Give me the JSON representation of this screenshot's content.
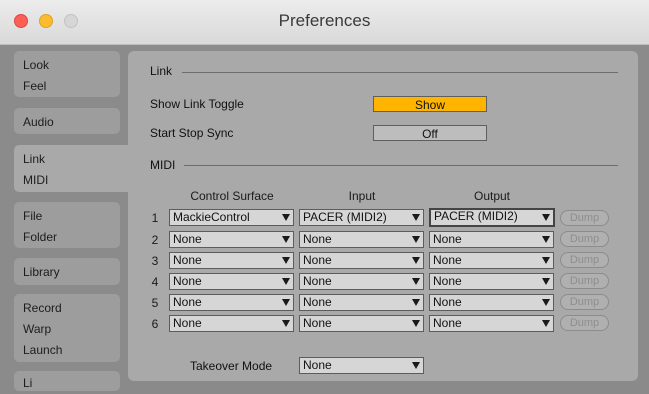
{
  "window": {
    "title": "Preferences"
  },
  "tabs": [
    {
      "lines": [
        "Look",
        "Feel"
      ]
    },
    {
      "lines": [
        "Audio"
      ]
    },
    {
      "lines": [
        "Link",
        "MIDI"
      ],
      "active": true
    },
    {
      "lines": [
        "File",
        "Folder"
      ]
    },
    {
      "lines": [
        "Library"
      ]
    },
    {
      "lines": [
        "Record",
        "Warp",
        "Launch"
      ]
    },
    {
      "lines": [
        "Li"
      ]
    }
  ],
  "link": {
    "heading": "Link",
    "show_link_toggle_label": "Show Link Toggle",
    "show_link_toggle_value": "Show",
    "start_stop_sync_label": "Start Stop Sync",
    "start_stop_sync_value": "Off"
  },
  "midi": {
    "heading": "MIDI",
    "columns": {
      "control_surface": "Control Surface",
      "input": "Input",
      "output": "Output"
    },
    "dump_label": "Dump",
    "rows": [
      {
        "num": "1",
        "surface": "MackieControl",
        "input": "PACER (MIDI2)",
        "output": "PACER (MIDI2)"
      },
      {
        "num": "2",
        "surface": "None",
        "input": "None",
        "output": "None"
      },
      {
        "num": "3",
        "surface": "None",
        "input": "None",
        "output": "None"
      },
      {
        "num": "4",
        "surface": "None",
        "input": "None",
        "output": "None"
      },
      {
        "num": "5",
        "surface": "None",
        "input": "None",
        "output": "None"
      },
      {
        "num": "6",
        "surface": "None",
        "input": "None",
        "output": "None"
      }
    ],
    "takeover_label": "Takeover Mode",
    "takeover_value": "None"
  },
  "colors": {
    "accent_toggle": "#ffb400",
    "panel": "#a9a9a9",
    "background": "#8b8b8b"
  }
}
